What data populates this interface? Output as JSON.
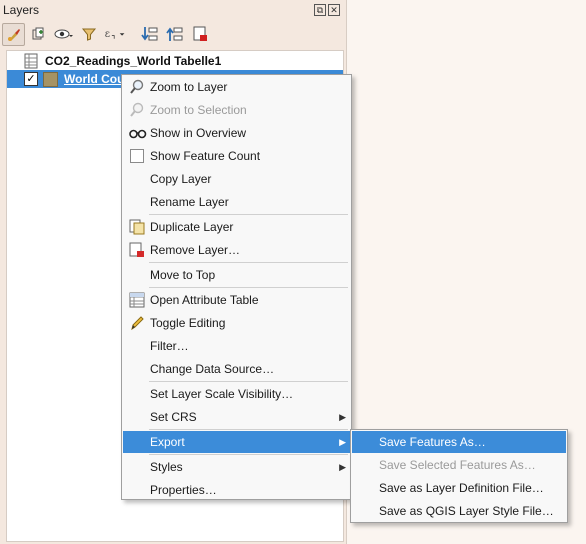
{
  "panel": {
    "title": "Layers",
    "float_glyph": "⧉",
    "close_glyph": "✕"
  },
  "tree": {
    "table_layer": "CO2_Readings_World Tabelle1",
    "world_layer": "World Cou",
    "world_checked": "✓"
  },
  "menu": {
    "items": [
      {
        "label": "Zoom to Layer",
        "icon": "zoom-icon",
        "disabled": false
      },
      {
        "label": "Zoom to Selection",
        "icon": "zoom-icon",
        "disabled": true
      },
      {
        "label": "Show in Overview",
        "icon": "glasses-icon",
        "disabled": false
      },
      {
        "label": "Show Feature Count",
        "icon": "checkbox-icon",
        "disabled": false
      },
      {
        "label": "Copy Layer",
        "icon": "",
        "disabled": false
      },
      {
        "label": "Rename Layer",
        "icon": "",
        "disabled": false
      },
      {
        "label": "Duplicate Layer",
        "icon": "duplicate-icon",
        "disabled": false
      },
      {
        "label": "Remove Layer…",
        "icon": "remove-icon",
        "disabled": false
      },
      {
        "label": "Move to Top",
        "icon": "",
        "disabled": false
      },
      {
        "label": "Open Attribute Table",
        "icon": "table-icon",
        "disabled": false
      },
      {
        "label": "Toggle Editing",
        "icon": "pencil-icon",
        "disabled": false
      },
      {
        "label": "Filter…",
        "icon": "",
        "disabled": false
      },
      {
        "label": "Change Data Source…",
        "icon": "",
        "disabled": false
      },
      {
        "label": "Set Layer Scale Visibility…",
        "icon": "",
        "disabled": false
      },
      {
        "label": "Set CRS",
        "icon": "",
        "disabled": false,
        "submenu": true
      },
      {
        "label": "Export",
        "icon": "",
        "disabled": false,
        "submenu": true,
        "active": true
      },
      {
        "label": "Styles",
        "icon": "",
        "disabled": false,
        "submenu": true
      },
      {
        "label": "Properties…",
        "icon": "",
        "disabled": false
      }
    ],
    "submenu_arrow": "▶"
  },
  "export_menu": {
    "items": [
      {
        "label": "Save Features As…",
        "disabled": false,
        "active": true
      },
      {
        "label": "Save Selected Features As…",
        "disabled": true
      },
      {
        "label": "Save as Layer Definition File…",
        "disabled": false
      },
      {
        "label": "Save as QGIS Layer Style File…",
        "disabled": false
      }
    ]
  },
  "toolbar": {
    "icons": [
      "style-brush-icon",
      "add-group-icon",
      "visibility-eye-icon",
      "filter-icon",
      "expression-filter-icon",
      "expand-all-icon",
      "collapse-all-icon",
      "remove-layer-icon"
    ]
  },
  "colors": {
    "highlight": "#3c8cd9",
    "panel_bg": "#f4e8df"
  }
}
